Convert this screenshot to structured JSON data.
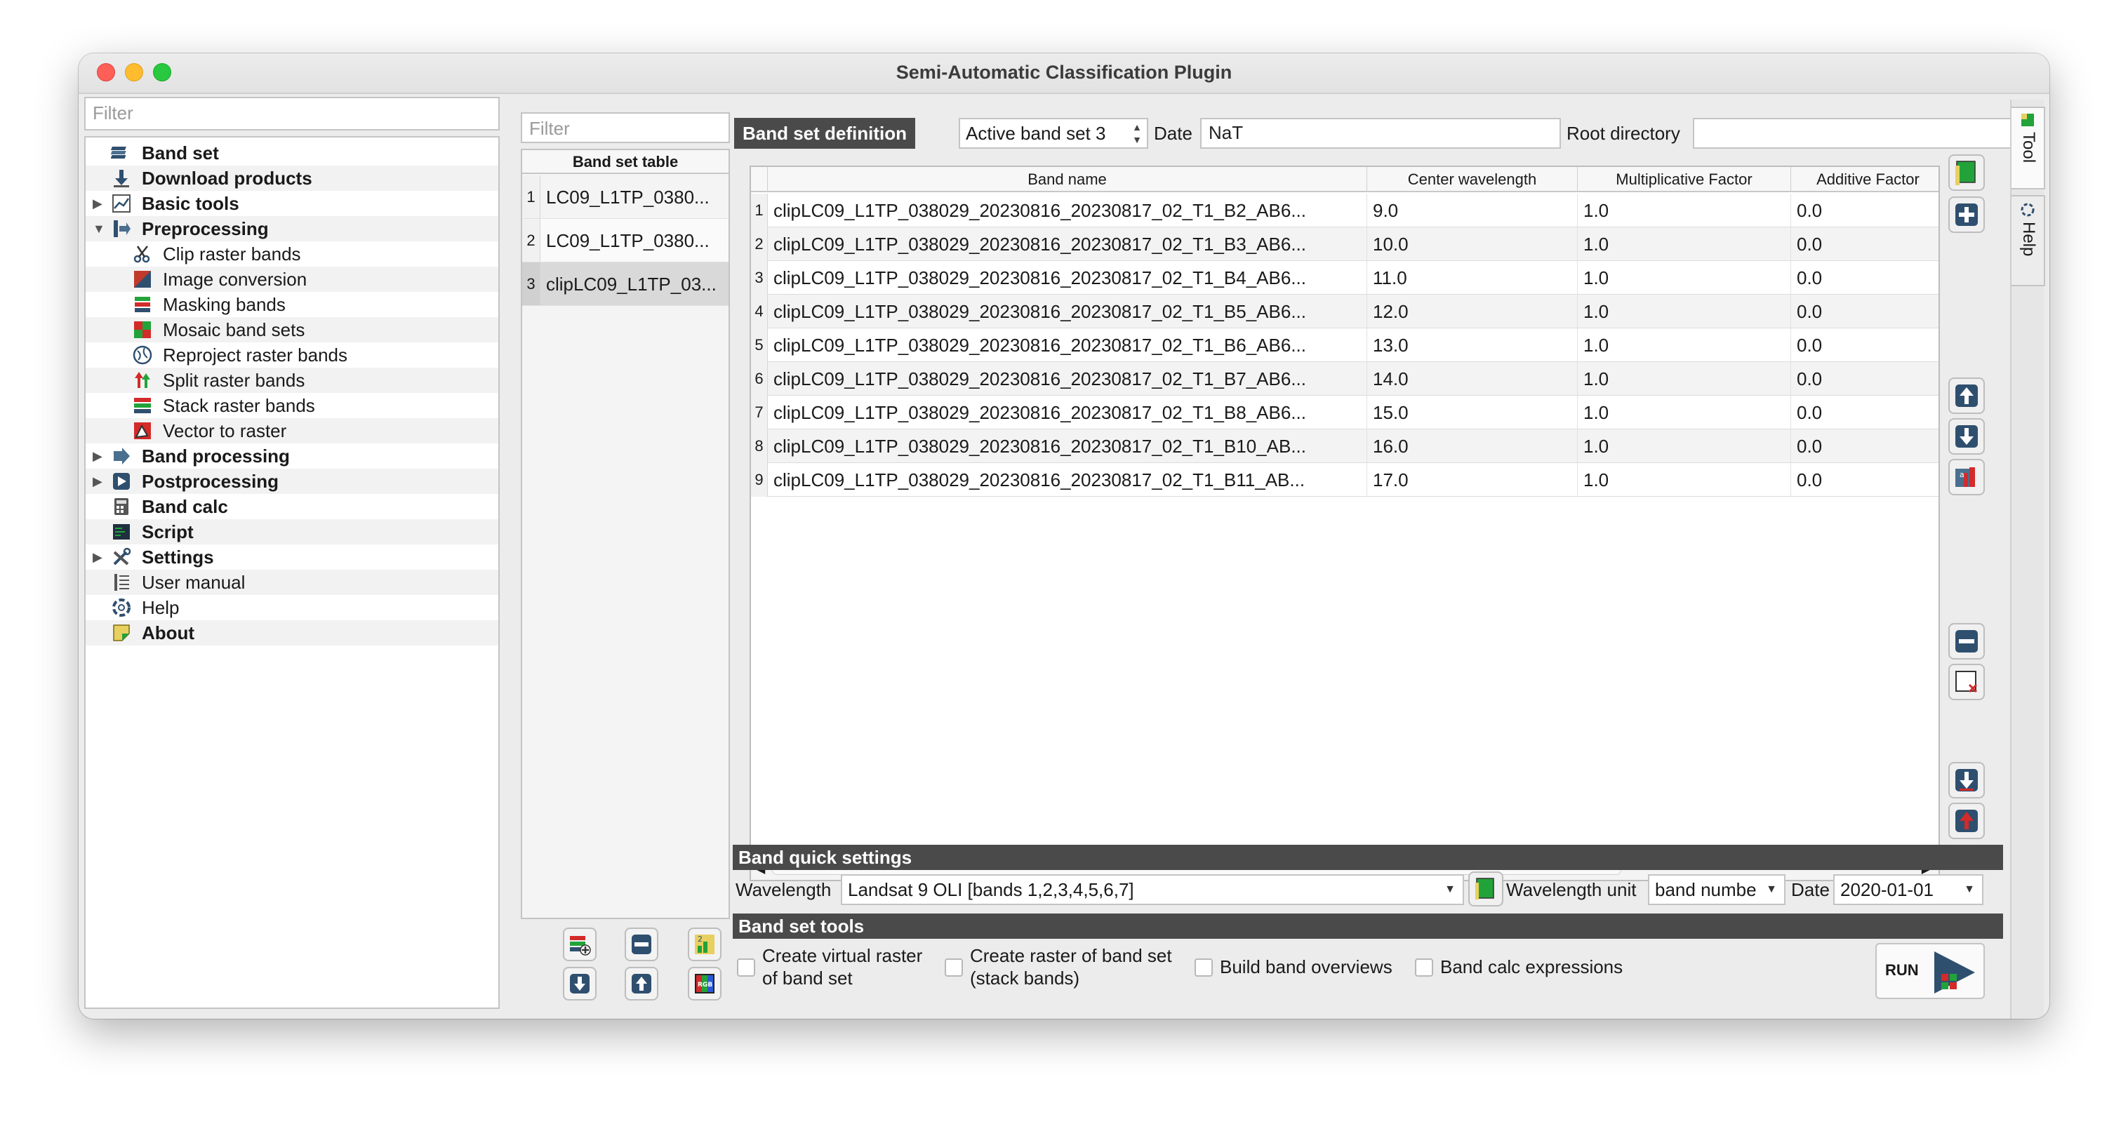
{
  "window": {
    "title": "Semi-Automatic Classification Plugin"
  },
  "menu": {
    "filter_placeholder": "Filter",
    "items": [
      {
        "label": "Band set"
      },
      {
        "label": "Download products"
      },
      {
        "label": "Basic tools"
      },
      {
        "label": "Preprocessing"
      },
      {
        "label": "Clip raster bands"
      },
      {
        "label": "Image conversion"
      },
      {
        "label": "Masking bands"
      },
      {
        "label": "Mosaic band sets"
      },
      {
        "label": "Reproject raster bands"
      },
      {
        "label": "Split raster bands"
      },
      {
        "label": "Stack raster bands"
      },
      {
        "label": "Vector to raster"
      },
      {
        "label": "Band processing"
      },
      {
        "label": "Postprocessing"
      },
      {
        "label": "Band calc"
      },
      {
        "label": "Script"
      },
      {
        "label": "Settings"
      },
      {
        "label": "User manual"
      },
      {
        "label": "Help"
      },
      {
        "label": "About"
      }
    ]
  },
  "band_set_table": {
    "filter_placeholder": "Filter",
    "header": "Band set table",
    "rows": [
      {
        "num": "1",
        "name": "LC09_L1TP_0380..."
      },
      {
        "num": "2",
        "name": "LC09_L1TP_0380..."
      },
      {
        "num": "3",
        "name": "clipLC09_L1TP_03..."
      }
    ]
  },
  "definition": {
    "title": "Band set definition",
    "active_band_set": "Active band set 3",
    "date_label": "Date",
    "date_value": "NaT",
    "root_label": "Root directory",
    "root_value": ""
  },
  "band_table": {
    "headers": [
      "Band name",
      "Center wavelength",
      "Multiplicative Factor",
      "Additive Factor"
    ],
    "rows": [
      {
        "num": "1",
        "name": "clipLC09_L1TP_038029_20230816_20230817_02_T1_B2_AB6...",
        "wl": "9.0",
        "mult": "1.0",
        "add": "0.0"
      },
      {
        "num": "2",
        "name": "clipLC09_L1TP_038029_20230816_20230817_02_T1_B3_AB6...",
        "wl": "10.0",
        "mult": "1.0",
        "add": "0.0"
      },
      {
        "num": "3",
        "name": "clipLC09_L1TP_038029_20230816_20230817_02_T1_B4_AB6...",
        "wl": "11.0",
        "mult": "1.0",
        "add": "0.0"
      },
      {
        "num": "4",
        "name": "clipLC09_L1TP_038029_20230816_20230817_02_T1_B5_AB6...",
        "wl": "12.0",
        "mult": "1.0",
        "add": "0.0"
      },
      {
        "num": "5",
        "name": "clipLC09_L1TP_038029_20230816_20230817_02_T1_B6_AB6...",
        "wl": "13.0",
        "mult": "1.0",
        "add": "0.0"
      },
      {
        "num": "6",
        "name": "clipLC09_L1TP_038029_20230816_20230817_02_T1_B7_AB6...",
        "wl": "14.0",
        "mult": "1.0",
        "add": "0.0"
      },
      {
        "num": "7",
        "name": "clipLC09_L1TP_038029_20230816_20230817_02_T1_B8_AB6...",
        "wl": "15.0",
        "mult": "1.0",
        "add": "0.0"
      },
      {
        "num": "8",
        "name": "clipLC09_L1TP_038029_20230816_20230817_02_T1_B10_AB...",
        "wl": "16.0",
        "mult": "1.0",
        "add": "0.0"
      },
      {
        "num": "9",
        "name": "clipLC09_L1TP_038029_20230816_20230817_02_T1_B11_AB...",
        "wl": "17.0",
        "mult": "1.0",
        "add": "0.0"
      }
    ]
  },
  "quick_settings": {
    "title": "Band quick settings",
    "wavelength_label": "Wavelength",
    "wavelength_value": "Landsat 9 OLI [bands 1,2,3,4,5,6,7]",
    "unit_label": "Wavelength unit",
    "unit_value": "band numbe",
    "date_label": "Date",
    "date_value": "2020-01-01"
  },
  "tools": {
    "title": "Band set tools",
    "opt_virtual_line1": "Create virtual raster",
    "opt_virtual_line2": "of band set",
    "opt_stack_line1": "Create raster of band set",
    "opt_stack_line2": "(stack bands)",
    "opt_overviews": "Build band overviews",
    "opt_calc": "Band calc expressions",
    "run_label": "RUN"
  },
  "side_tabs": {
    "tool": "Tool",
    "help": "Help"
  },
  "colors": {
    "header_dark": "#4a4a4a",
    "accent_green": "#22a33a",
    "accent_red": "#d32a2a",
    "button_blue": "#2f4f6f"
  }
}
